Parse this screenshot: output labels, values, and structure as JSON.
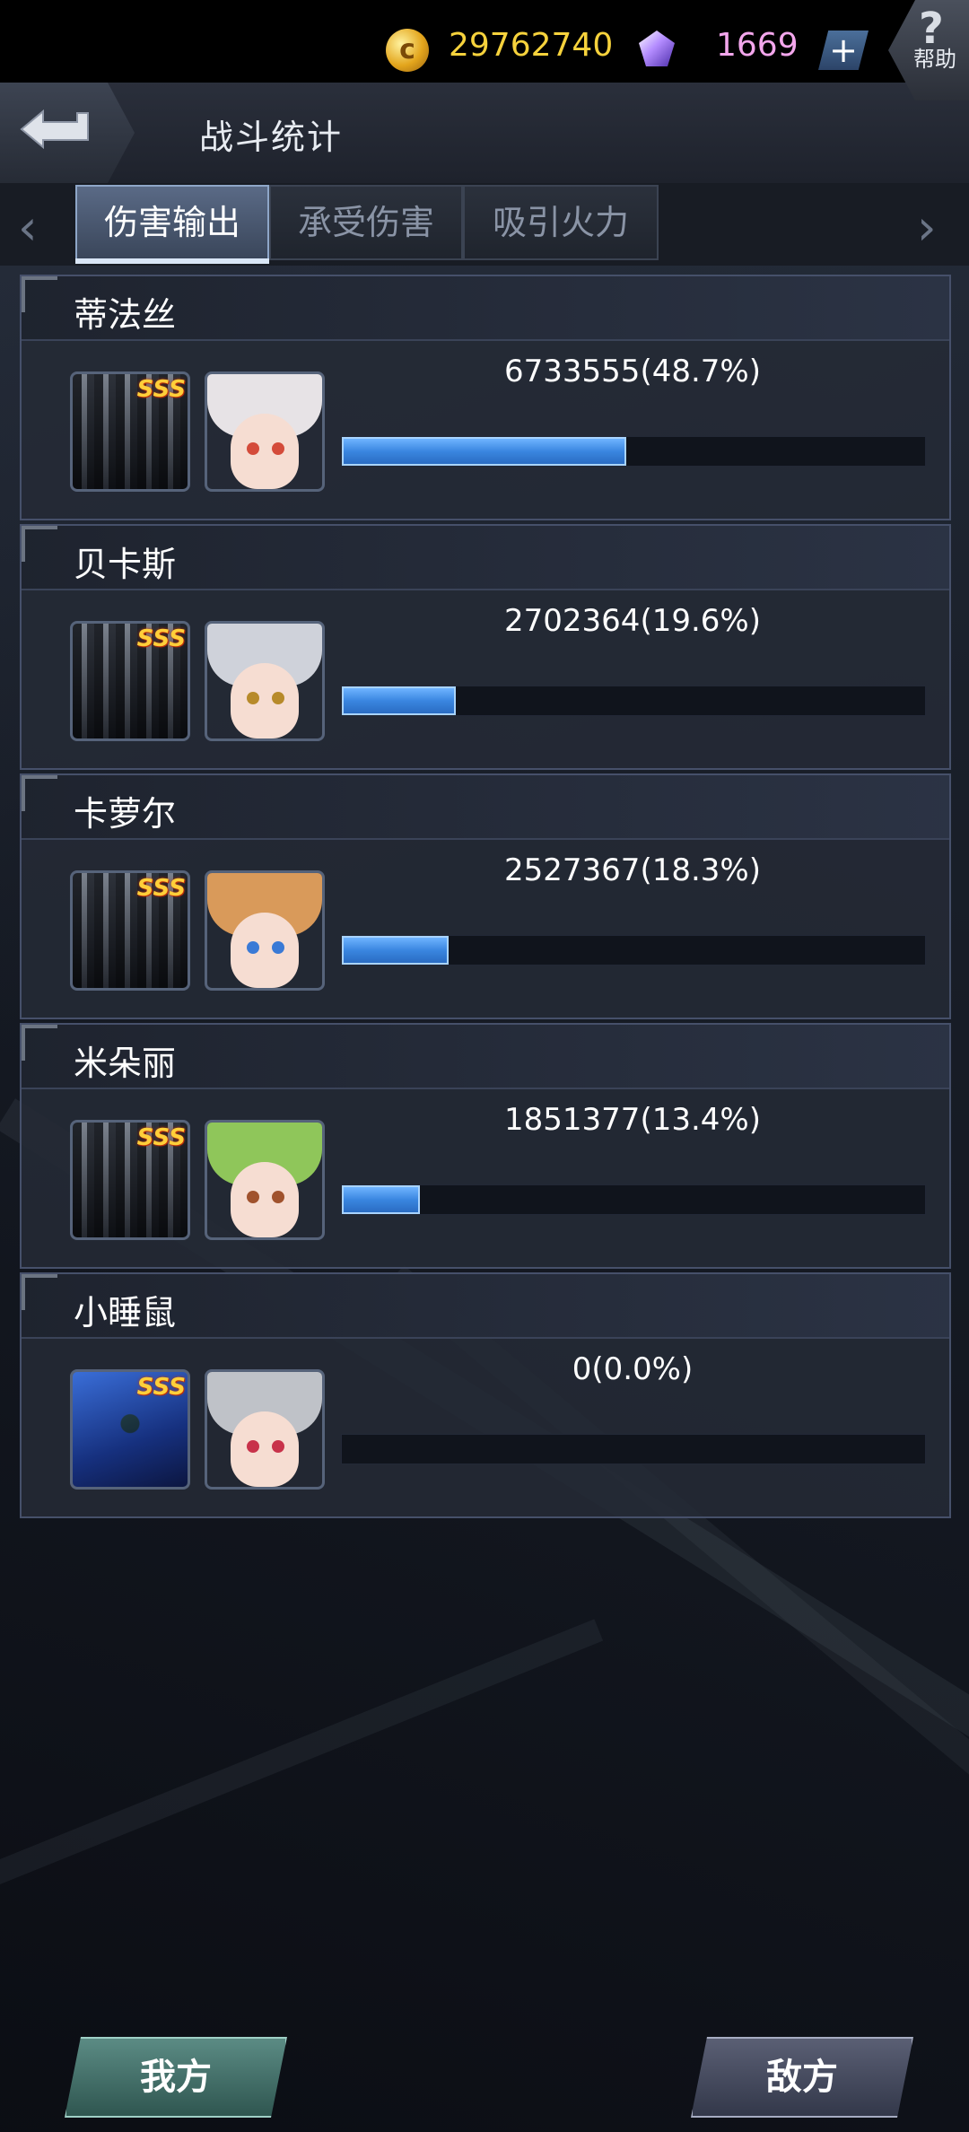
{
  "header": {
    "title": "战斗统计",
    "coins": "29762740",
    "gems": "1669",
    "plus": "+",
    "help_symbol": "?",
    "help_label": "帮助"
  },
  "tabs": [
    {
      "label": "伤害输出",
      "active": true
    },
    {
      "label": "承受伤害",
      "active": false
    },
    {
      "label": "吸引火力",
      "active": false
    }
  ],
  "nav_arrows": {
    "left": "‹",
    "right": "›"
  },
  "mech_rank_label": "SSS",
  "rows": [
    {
      "name": "蒂法丝",
      "value_text": "6733555(48.7%)",
      "fraction": 0.487,
      "mech": "white-mech",
      "portrait_hair": "#e7e3e6",
      "eye": "#d44b3a"
    },
    {
      "name": "贝卡斯",
      "value_text": "2702364(19.6%)",
      "fraction": 0.196,
      "mech": "white-mech",
      "portrait_hair": "#cfd2da",
      "eye": "#b78a2a"
    },
    {
      "name": "卡萝尔",
      "value_text": "2527367(18.3%)",
      "fraction": 0.183,
      "mech": "white-mech",
      "portrait_hair": "#d99a5a",
      "eye": "#3a7ad6"
    },
    {
      "name": "米朵丽",
      "value_text": "1851377(13.4%)",
      "fraction": 0.134,
      "mech": "white-mech",
      "portrait_hair": "#8fc65a",
      "eye": "#a0522d"
    },
    {
      "name": "小睡鼠",
      "value_text": "0(0.0%)",
      "fraction": 0.0,
      "mech": "blue-mech",
      "portrait_hair": "#bfc2c8",
      "eye": "#c8324a"
    }
  ],
  "buttons": {
    "ours": "我方",
    "enemy": "敌方"
  }
}
